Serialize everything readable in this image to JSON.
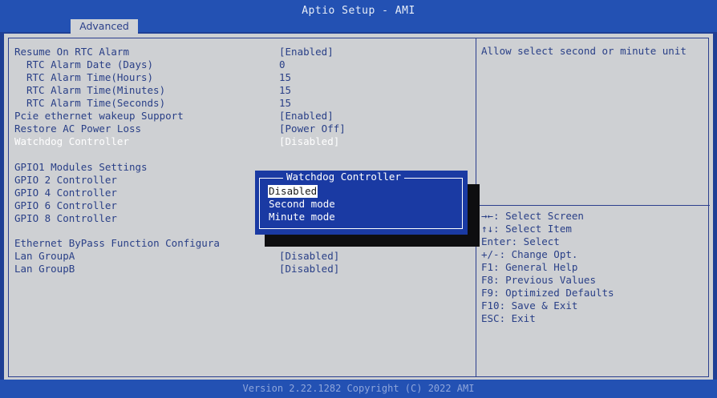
{
  "app": {
    "title": "Aptio Setup - AMI",
    "active_tab": "Advanced"
  },
  "settings": [
    {
      "label": "Resume On RTC Alarm",
      "value": "[Enabled]",
      "indent": 0
    },
    {
      "label": "RTC Alarm Date (Days)",
      "value": "0",
      "indent": 1
    },
    {
      "label": "RTC Alarm Time(Hours)",
      "value": "15",
      "indent": 1
    },
    {
      "label": "RTC Alarm Time(Minutes)",
      "value": "15",
      "indent": 1
    },
    {
      "label": "RTC Alarm Time(Seconds)",
      "value": "15",
      "indent": 1
    },
    {
      "label": "Pcie ethernet wakeup Support",
      "value": "[Enabled]",
      "indent": 0
    },
    {
      "label": "Restore AC Power Loss",
      "value": "[Power Off]",
      "indent": 0
    },
    {
      "label": "Watchdog Controller",
      "value": "[Disabled]",
      "indent": 0,
      "selected": true
    },
    {
      "label": "",
      "value": ""
    },
    {
      "label": "GPIO1 Modules Settings",
      "value": "",
      "indent": 0
    },
    {
      "label": "GPIO 2 Controller",
      "value": "",
      "indent": 0
    },
    {
      "label": "GPIO 4 Controller",
      "value": "",
      "indent": 0
    },
    {
      "label": "GPIO 6 Controller",
      "value": "",
      "indent": 0
    },
    {
      "label": "GPIO 8 Controller",
      "value": "",
      "indent": 0
    },
    {
      "label": "",
      "value": ""
    },
    {
      "label": "Ethernet ByPass Function Configura",
      "value": "",
      "indent": 0
    },
    {
      "label": "Lan GroupA",
      "value": "[Disabled]",
      "indent": 0
    },
    {
      "label": "Lan GroupB",
      "value": "[Disabled]",
      "indent": 0
    }
  ],
  "help": {
    "text": "Allow select second or minute unit"
  },
  "keys": [
    "→←: Select Screen",
    "↑↓: Select Item",
    "Enter: Select",
    "+/-: Change Opt.",
    "F1: General Help",
    "F8: Previous Values",
    "F9: Optimized Defaults",
    "F10: Save & Exit",
    "ESC: Exit"
  ],
  "popup": {
    "title": "Watchdog Controller",
    "options": [
      {
        "label": "Disabled",
        "selected": true
      },
      {
        "label": "Second mode",
        "selected": false
      },
      {
        "label": "Minute mode",
        "selected": false
      }
    ]
  },
  "footer": {
    "text": "Version 2.22.1282 Copyright (C) 2022 AMI"
  },
  "colors": {
    "header_blue": "#2351b3",
    "panel_gray": "#ced0d3",
    "text_blue": "#293f87",
    "popup_blue": "#1a3aa3"
  }
}
